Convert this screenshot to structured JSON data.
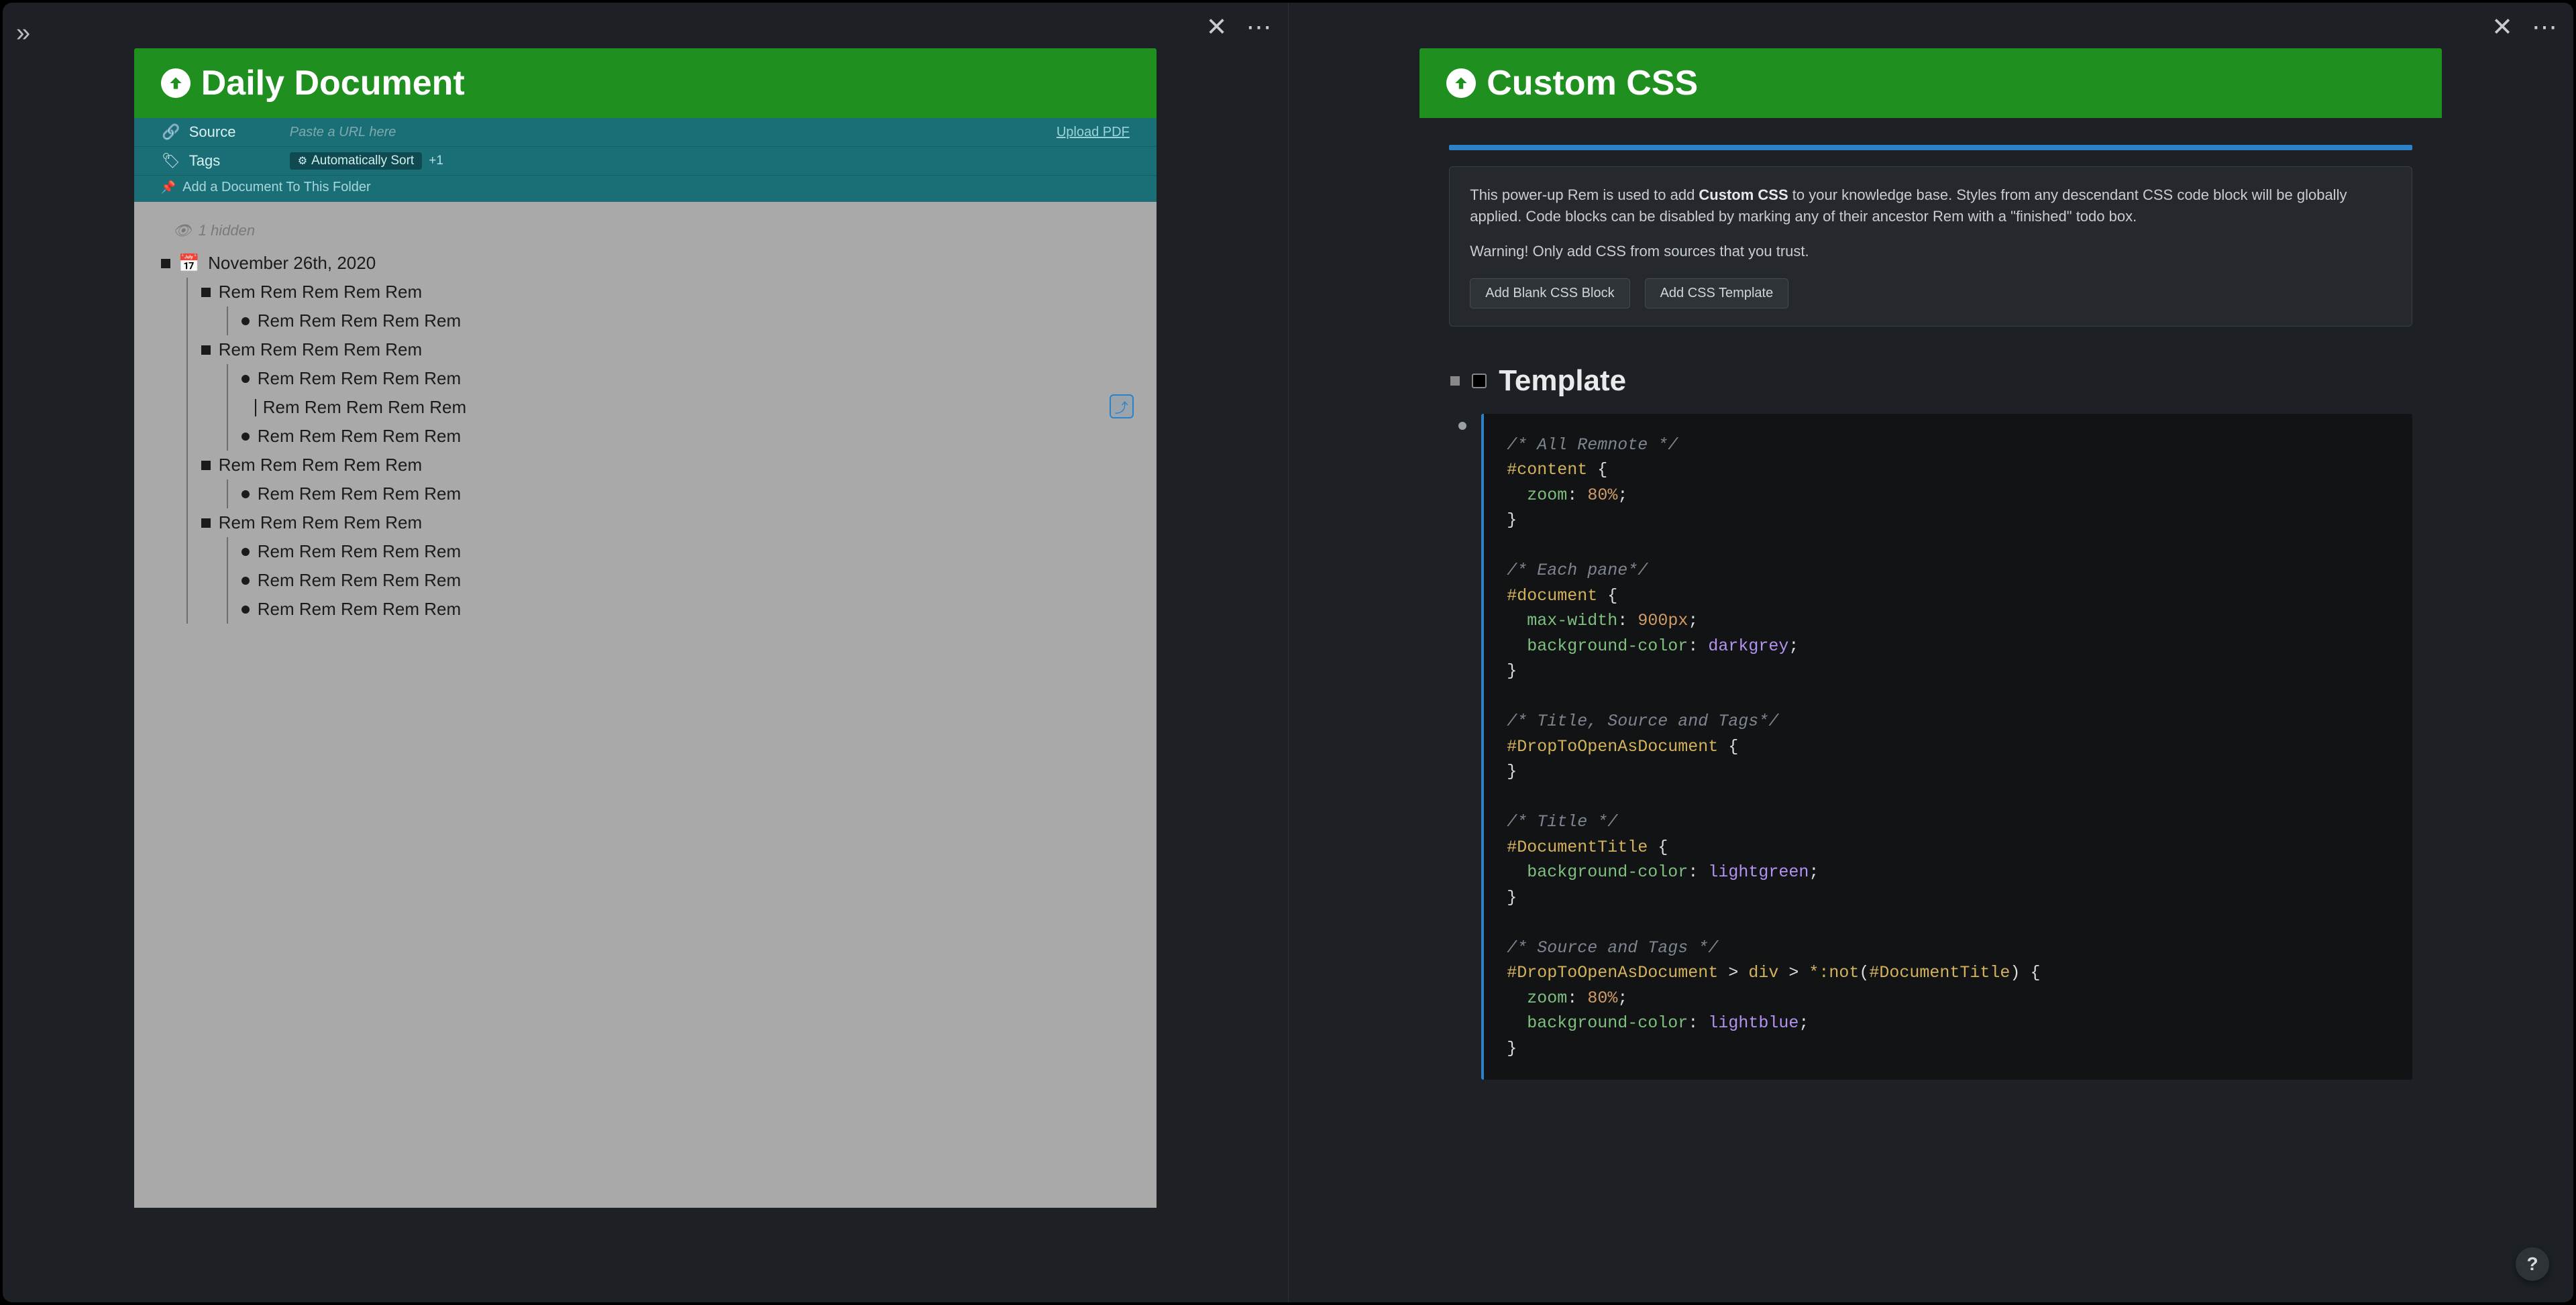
{
  "app": {
    "sidebar_toggle_glyph": "»",
    "help_glyph": "?"
  },
  "left_pane": {
    "close_glyph": "✕",
    "more_glyph": "⋯",
    "title": "Daily Document",
    "source": {
      "label": "Source",
      "placeholder": "Paste a URL here",
      "upload_label": "Upload PDF"
    },
    "tags": {
      "label": "Tags",
      "auto_sort_label": "Automatically Sort",
      "extra": "+1"
    },
    "add_doc_label": "Add a Document To This Folder",
    "hidden_label": "1 hidden",
    "date_heading": "November 26th, 2020",
    "rem_text": "Rem Rem Rem Rem Rem",
    "outline": [
      {
        "text": "Rem Rem Rem Rem Rem",
        "children": [
          {
            "text": "Rem Rem Rem Rem Rem"
          }
        ]
      },
      {
        "text": "Rem Rem Rem Rem Rem",
        "children": [
          {
            "text": "Rem Rem Rem Rem Rem"
          },
          {
            "text": "Rem Rem Rem Rem Rem",
            "cursor": true,
            "indent": true
          },
          {
            "text": "Rem Rem Rem Rem Rem"
          }
        ]
      },
      {
        "text": "Rem Rem Rem Rem Rem",
        "children": [
          {
            "text": "Rem Rem Rem Rem Rem"
          }
        ]
      },
      {
        "text": "Rem Rem Rem Rem Rem",
        "children": [
          {
            "text": "Rem Rem Rem Rem Rem"
          },
          {
            "text": "Rem Rem Rem Rem Rem"
          },
          {
            "text": "Rem Rem Rem Rem Rem"
          }
        ]
      }
    ]
  },
  "right_pane": {
    "close_glyph": "✕",
    "more_glyph": "⋯",
    "title": "Custom CSS",
    "info": {
      "prefix": "This power-up Rem is used to add ",
      "bold": "Custom CSS",
      "suffix": " to your knowledge base. Styles from any descendant CSS code block will be globally applied. Code blocks can be disabled by marking any of their ancestor Rem with a \"finished\" todo box.",
      "warning": "Warning! Only add CSS from sources that you trust."
    },
    "buttons": {
      "blank": "Add Blank CSS Block",
      "template": "Add CSS Template"
    },
    "template_heading": "Template",
    "css_lines": [
      {
        "t": "c",
        "s": "/* All Remnote */"
      },
      {
        "t": "sel",
        "s": "#content",
        "open": true
      },
      {
        "t": "prop",
        "s": "zoom",
        "v": "80%",
        "vt": "pct",
        "indent": 1
      },
      {
        "t": "close"
      },
      {
        "t": "blank"
      },
      {
        "t": "c",
        "s": "/* Each pane*/"
      },
      {
        "t": "sel",
        "s": "#document",
        "open": true
      },
      {
        "t": "prop",
        "s": "max-width",
        "v": "900px",
        "vt": "num",
        "indent": 1
      },
      {
        "t": "prop",
        "s": "background-color",
        "v": "darkgrey",
        "vt": "val",
        "indent": 1
      },
      {
        "t": "close"
      },
      {
        "t": "blank"
      },
      {
        "t": "c",
        "s": "/* Title, Source and Tags*/"
      },
      {
        "t": "sel",
        "s": "#DropToOpenAsDocument",
        "open": true
      },
      {
        "t": "close"
      },
      {
        "t": "blank"
      },
      {
        "t": "c",
        "s": "/* Title */"
      },
      {
        "t": "sel",
        "s": "#DocumentTitle",
        "open": true
      },
      {
        "t": "prop",
        "s": "background-color",
        "v": "lightgreen",
        "vt": "val",
        "indent": 1
      },
      {
        "t": "close"
      },
      {
        "t": "blank"
      },
      {
        "t": "c",
        "s": "/* Source and Tags */"
      },
      {
        "t": "selraw",
        "s": "#DropToOpenAsDocument > div > *:not(#DocumentTitle)",
        "open": true
      },
      {
        "t": "prop",
        "s": "zoom",
        "v": "80%",
        "vt": "pct",
        "indent": 1
      },
      {
        "t": "prop",
        "s": "background-color",
        "v": "lightblue",
        "vt": "val",
        "indent": 1
      },
      {
        "t": "close"
      }
    ]
  }
}
